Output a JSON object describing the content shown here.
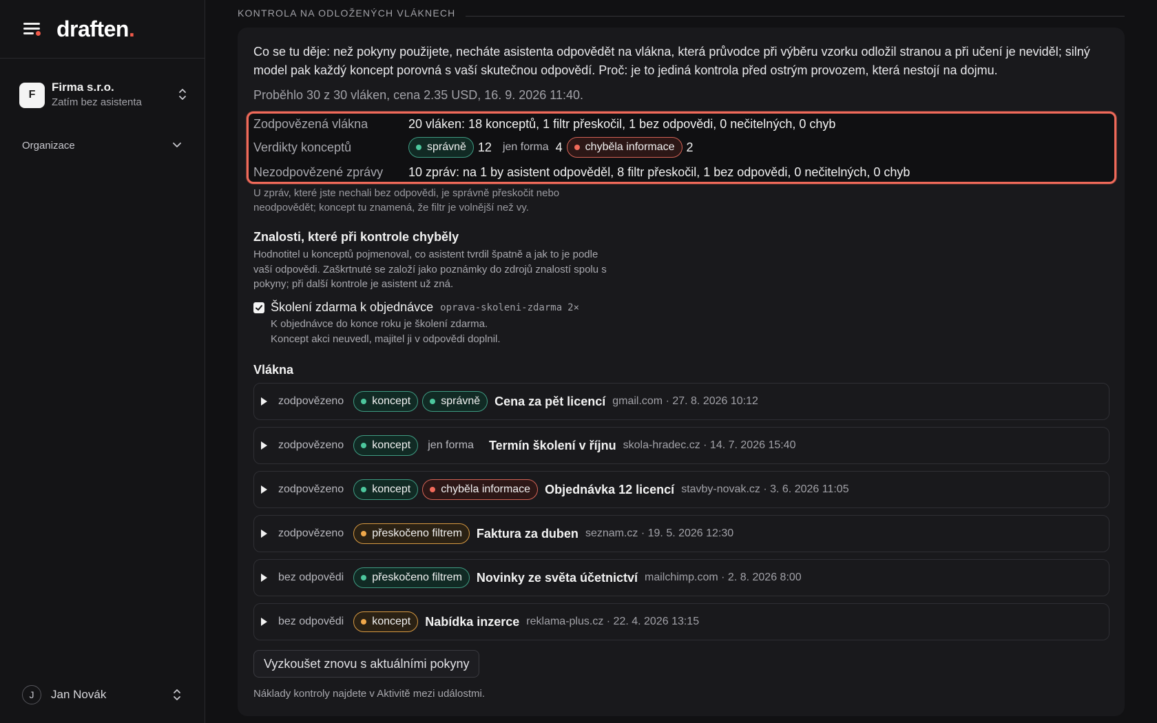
{
  "sidebar": {
    "logo_text": "draften",
    "logo_dot": ".",
    "org": {
      "avatar_letter": "F",
      "name": "Firma s.r.o.",
      "subtitle": "Zatím bez asistenta"
    },
    "section_label": "Organizace",
    "user": {
      "avatar_letter": "J",
      "name": "Jan Novák"
    }
  },
  "main": {
    "section_title": "KONTROLA NA ODLOŽENÝCH VLÁKNECH",
    "intro": "Co se tu děje: než pokyny použijete, necháte asistenta odpovědět na vlákna, která průvodce při výběru vzorku odložil stranou a při učení je neviděl; silný model pak každý koncept porovná s vaší skutečnou odpovědí. Proč: je to jediná kontrola před ostrým provozem, která nestojí na dojmu.",
    "run_info": "Proběhlo 30 z 30 vláken, cena 2.35 USD, 16. 9. 2026 11:40.",
    "stats": {
      "answered_label": "Zodpovězená vlákna",
      "answered_value": "20 vláken: 18 konceptů, 1 filtr přeskočil, 1 bez odpovědi, 0 nečitelných, 0 chyb",
      "verdicts_label": "Verdikty konceptů",
      "verdicts": [
        {
          "label": "správně",
          "count": "12",
          "style": "green"
        },
        {
          "label": "jen forma",
          "count": "4",
          "style": "plain"
        },
        {
          "label": "chyběla informace",
          "count": "2",
          "style": "red"
        }
      ],
      "unanswered_label": "Nezodpovězené zprávy",
      "unanswered_value": "10 zpráv: na 1 by asistent odpověděl, 8 filtr přeskočil, 1 bez odpovědi, 0 nečitelných, 0 chyb"
    },
    "unanswered_note": "U zpráv, které jste nechali bez odpovědi, je správně přeskočit nebo neodpovědět; koncept tu znamená, že filtr je volnější než vy.",
    "knowledge": {
      "title": "Znalosti, které při kontrole chyběly",
      "description": "Hodnotitel u konceptů pojmenoval, co asistent tvrdil špatně a jak to je podle vaší odpovědi. Zaškrtnuté se založí jako poznámky do zdrojů znalostí spolu s pokyny; při další kontrole je asistent už zná.",
      "item": {
        "checked": true,
        "title": "Školení zdarma k objednávce",
        "slug": "oprava-skoleni-zdarma",
        "count": "2×",
        "line1": "K objednávce do konce roku je školení zdarma.",
        "line2": "Koncept akci neuvedl, majitel ji v odpovědi doplnil."
      }
    },
    "threads_title": "Vlákna",
    "threads": [
      {
        "status": "zodpovězeno",
        "tags": [
          {
            "label": "koncept",
            "style": "green"
          },
          {
            "label": "správně",
            "style": "green"
          }
        ],
        "subject": "Cena za pět licencí",
        "meta": "gmail.com · 27. 8. 2026 10:12"
      },
      {
        "status": "zodpovězeno",
        "tags": [
          {
            "label": "koncept",
            "style": "green"
          },
          {
            "label": "jen forma",
            "style": "plain"
          }
        ],
        "subject": "Termín školení v říjnu",
        "meta": "skola-hradec.cz · 14. 7. 2026 15:40"
      },
      {
        "status": "zodpovězeno",
        "tags": [
          {
            "label": "koncept",
            "style": "green"
          },
          {
            "label": "chyběla informace",
            "style": "red"
          }
        ],
        "subject": "Objednávka 12 licencí",
        "meta": "stavby-novak.cz · 3. 6. 2026 11:05"
      },
      {
        "status": "zodpovězeno",
        "tags": [
          {
            "label": "přeskočeno filtrem",
            "style": "orange"
          }
        ],
        "subject": "Faktura za duben",
        "meta": "seznam.cz · 19. 5. 2026 12:30"
      },
      {
        "status": "bez odpovědi",
        "tags": [
          {
            "label": "přeskočeno filtrem",
            "style": "green"
          }
        ],
        "subject": "Novinky ze světa účetnictví",
        "meta": "mailchimp.com · 2. 8. 2026 8:00"
      },
      {
        "status": "bez odpovědi",
        "tags": [
          {
            "label": "koncept",
            "style": "orange"
          }
        ],
        "subject": "Nabídka inzerce",
        "meta": "reklama-plus.cz · 22. 4. 2026 13:15"
      }
    ],
    "retry_button": "Vyzkoušet znovu s aktuálními pokyny",
    "footer_note": "Náklady kontroly najdete v Aktivitě mezi událostmi."
  },
  "colors": {
    "background": "#111113",
    "highlight_border": "#f06a5a",
    "green": "#4cc79d",
    "red": "#f06a5a",
    "orange": "#f0a84a"
  },
  "icons": [
    "menu-icon",
    "chevron-updown-icon",
    "chevron-down-icon",
    "checkbox-checked-icon",
    "expand-triangle-icon"
  ]
}
